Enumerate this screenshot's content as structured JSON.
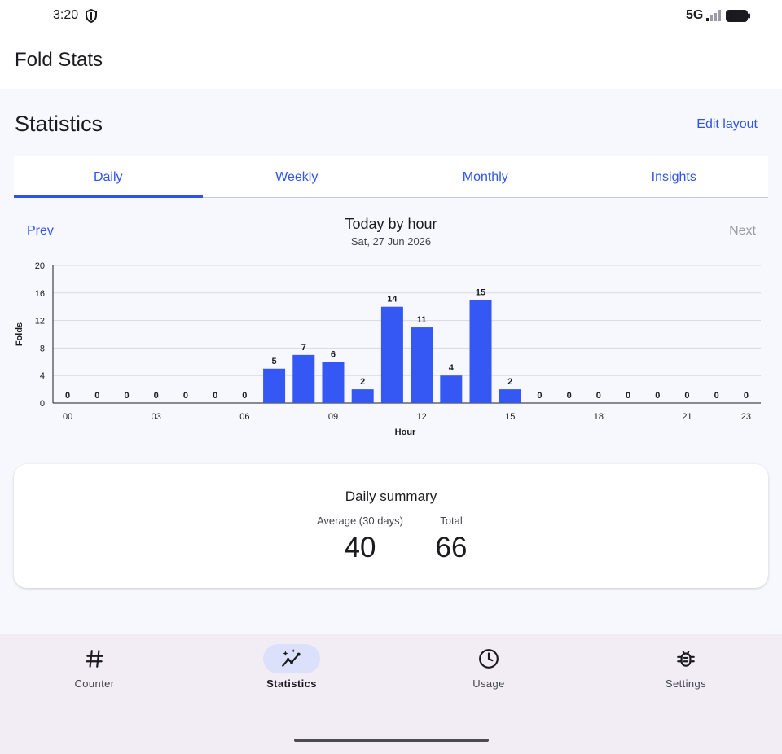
{
  "status_bar": {
    "time": "3:20",
    "network": "5G",
    "icons": [
      "shield-icon",
      "signal-icon",
      "battery-icon"
    ]
  },
  "app": {
    "title": "Fold Stats"
  },
  "page": {
    "title": "Statistics",
    "edit_layout_label": "Edit layout"
  },
  "tabs": [
    {
      "label": "Daily",
      "active": true
    },
    {
      "label": "Weekly",
      "active": false
    },
    {
      "label": "Monthly",
      "active": false
    },
    {
      "label": "Insights",
      "active": false
    }
  ],
  "chart_nav": {
    "prev_label": "Prev",
    "next_label": "Next",
    "next_enabled": false
  },
  "chart_data": {
    "type": "bar",
    "title": "Today by hour",
    "subtitle": "Sat, 27 Jun 2026",
    "xlabel": "Hour",
    "ylabel": "Folds",
    "categories": [
      "00",
      "01",
      "02",
      "03",
      "04",
      "05",
      "06",
      "07",
      "08",
      "09",
      "10",
      "11",
      "12",
      "13",
      "14",
      "15",
      "16",
      "17",
      "18",
      "19",
      "20",
      "21",
      "22",
      "23"
    ],
    "values": [
      0,
      0,
      0,
      0,
      0,
      0,
      0,
      5,
      7,
      6,
      2,
      14,
      11,
      4,
      15,
      2,
      0,
      0,
      0,
      0,
      0,
      0,
      0,
      0
    ],
    "x_tick_labels": [
      "00",
      "03",
      "06",
      "09",
      "12",
      "15",
      "18",
      "21",
      "23"
    ],
    "y_ticks": [
      0,
      4,
      8,
      12,
      16,
      20
    ],
    "ylim": [
      0,
      20
    ],
    "grid": true,
    "bar_color": "#3558f5",
    "data_labels": true
  },
  "summary": {
    "title": "Daily summary",
    "average_label": "Average (30 days)",
    "average_value": "40",
    "total_label": "Total",
    "total_value": "66"
  },
  "bottom_nav": [
    {
      "label": "Counter",
      "icon": "hash-icon",
      "active": false
    },
    {
      "label": "Statistics",
      "icon": "sparkle-chart-icon",
      "active": true
    },
    {
      "label": "Usage",
      "icon": "clock-icon",
      "active": false
    },
    {
      "label": "Settings",
      "icon": "bug-icon",
      "active": false
    }
  ],
  "colors": {
    "accent": "#2f54eb",
    "bar": "#3558f5",
    "nav_background": "#f2ecf4",
    "active_pill": "#dbe1fb"
  }
}
